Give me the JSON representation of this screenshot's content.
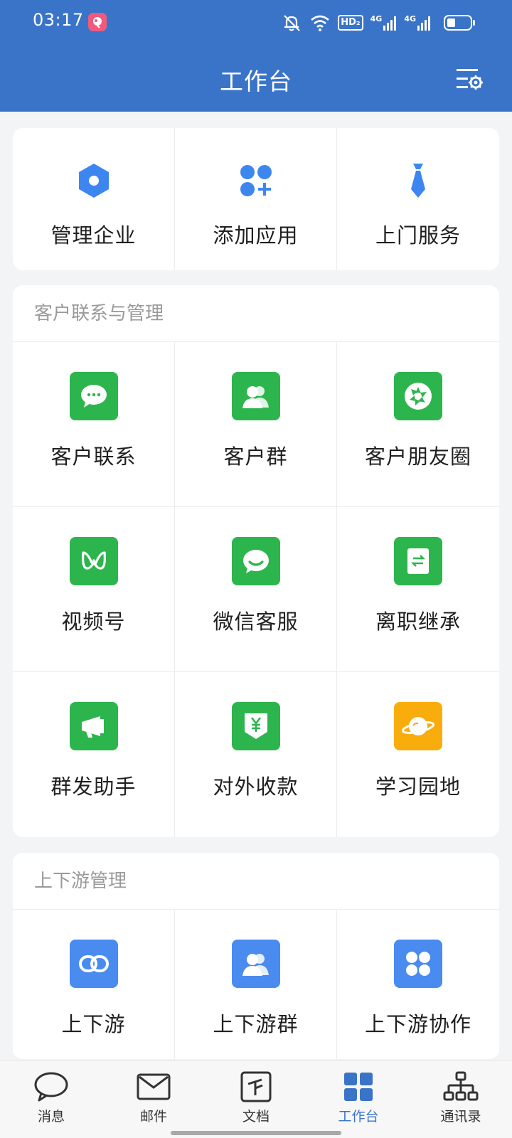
{
  "status_bar": {
    "time": "03:17",
    "hd_label": "HD₂",
    "net1": "4G",
    "net2": "4G",
    "battery_level": 0.25
  },
  "header": {
    "title": "工作台"
  },
  "quick_actions": [
    {
      "label": "管理企业",
      "icon": "hexagon-icon"
    },
    {
      "label": "添加应用",
      "icon": "add-app-icon"
    },
    {
      "label": "上门服务",
      "icon": "tie-icon"
    }
  ],
  "customer_section": {
    "title": "客户联系与管理",
    "items": [
      {
        "label": "客户联系",
        "icon": "chat-bubble-icon"
      },
      {
        "label": "客户群",
        "icon": "group-icon"
      },
      {
        "label": "客户朋友圈",
        "icon": "aperture-icon"
      },
      {
        "label": "视频号",
        "icon": "channels-icon"
      },
      {
        "label": "微信客服",
        "icon": "smile-chat-icon"
      },
      {
        "label": "离职继承",
        "icon": "transfer-doc-icon"
      },
      {
        "label": "群发助手",
        "icon": "megaphone-icon"
      },
      {
        "label": "对外收款",
        "icon": "payment-icon"
      },
      {
        "label": "学习园地",
        "icon": "planet-icon"
      }
    ]
  },
  "updown_section": {
    "title": "上下游管理",
    "items": [
      {
        "label": "上下游",
        "icon": "link-icon"
      },
      {
        "label": "上下游群",
        "icon": "group-icon"
      },
      {
        "label": "上下游协作",
        "icon": "four-dots-icon"
      }
    ]
  },
  "bottom_nav": [
    {
      "label": "消息",
      "icon": "message-icon"
    },
    {
      "label": "邮件",
      "icon": "mail-icon"
    },
    {
      "label": "文档",
      "icon": "document-icon"
    },
    {
      "label": "工作台",
      "icon": "workbench-icon",
      "active": true
    },
    {
      "label": "通讯录",
      "icon": "contacts-icon"
    }
  ],
  "colors": {
    "header": "#3a74c8",
    "green_tile": "#2db54d",
    "orange_tile": "#f9ad0c",
    "blue_tile": "#4a8bf0",
    "active_nav": "#3a74c8"
  }
}
